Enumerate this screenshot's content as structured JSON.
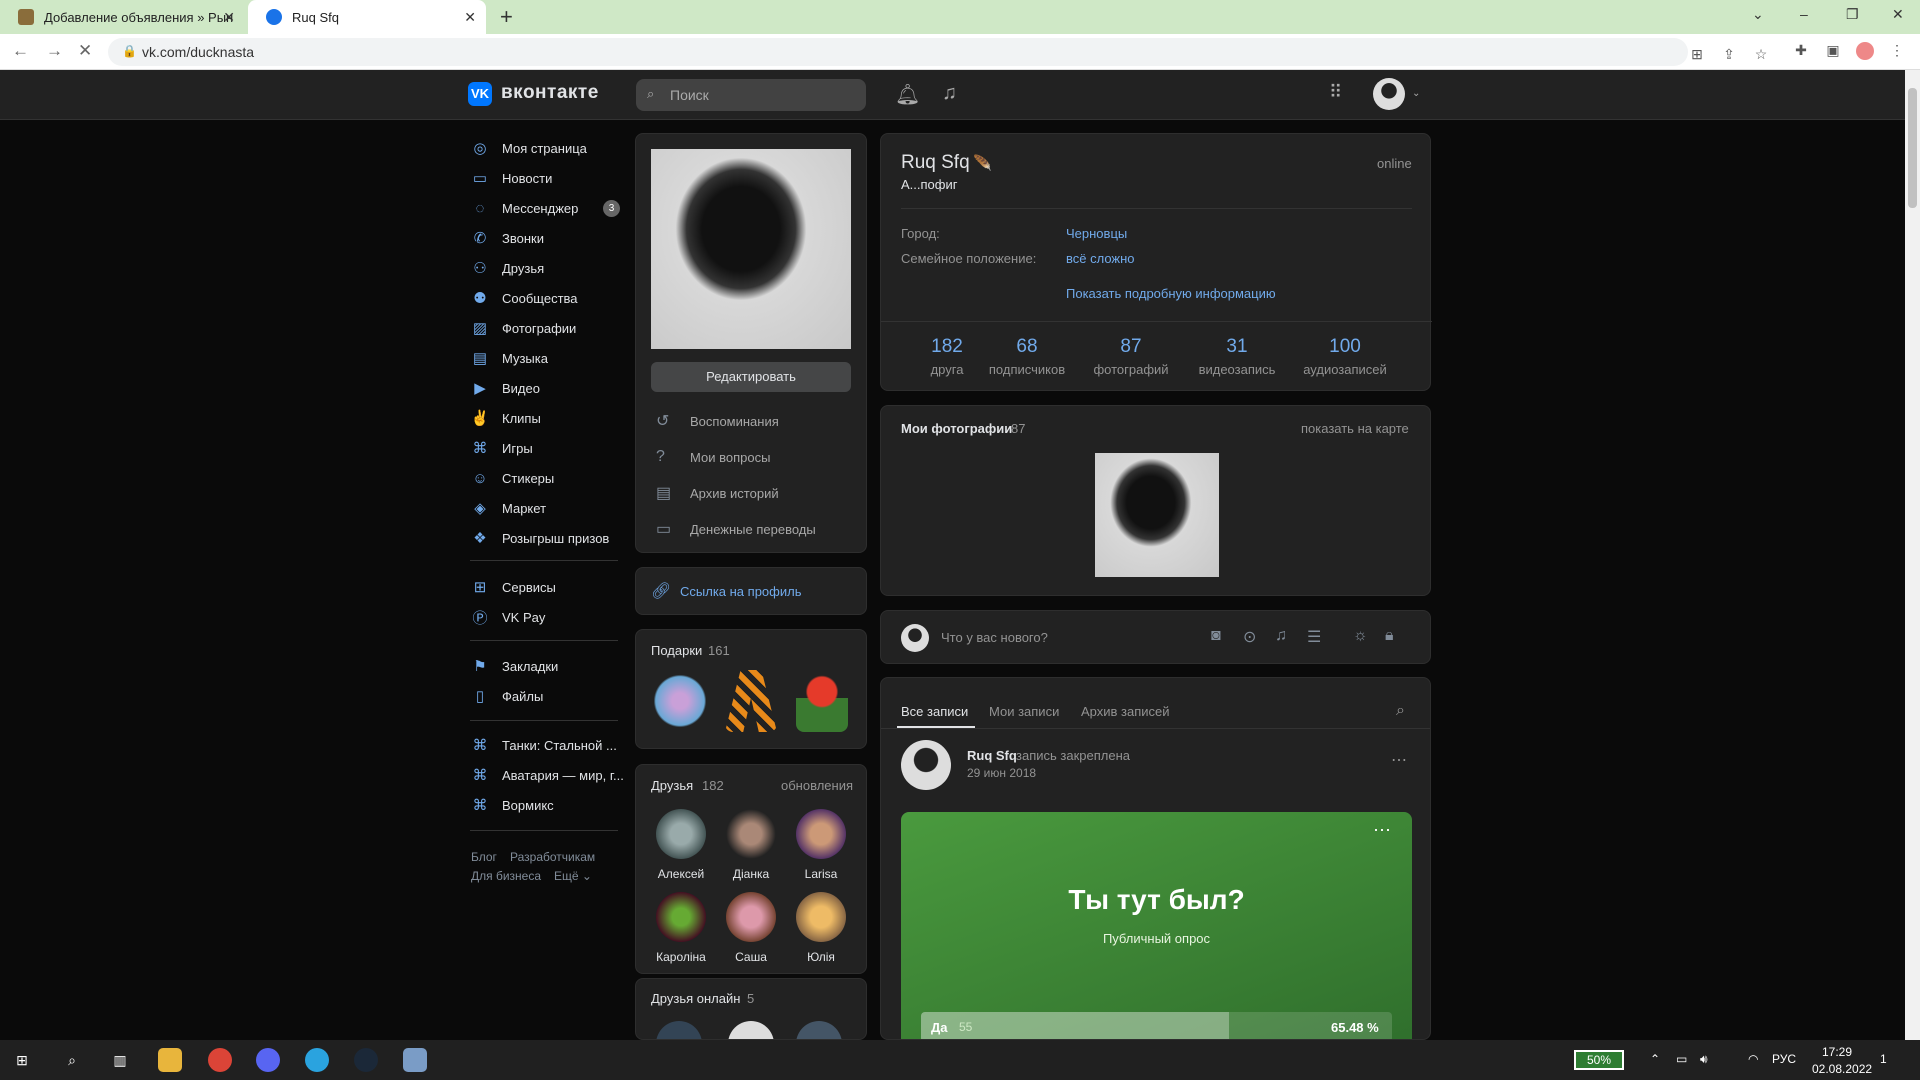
{
  "browser": {
    "tabs": [
      {
        "title": "Добавление объявления » Рын"
      },
      {
        "title": "Ruq Sfq"
      }
    ],
    "new_tab": "+",
    "url": "vk.com/ducknasta",
    "controls": {
      "minimize": "–",
      "restore": "❐",
      "close": "✕",
      "dropdown": "⌄"
    }
  },
  "vk_header": {
    "logo_letter": "VK",
    "logo_text": "вконтакте",
    "search_placeholder": "Поиск"
  },
  "sidebar": {
    "items": [
      {
        "label": "Моя страница",
        "icon": "user-circle-icon"
      },
      {
        "label": "Новости",
        "icon": "news-icon"
      },
      {
        "label": "Мессенджер",
        "icon": "message-icon",
        "badge": "3"
      },
      {
        "label": "Звонки",
        "icon": "phone-icon"
      },
      {
        "label": "Друзья",
        "icon": "friends-icon"
      },
      {
        "label": "Сообщества",
        "icon": "communities-icon"
      },
      {
        "label": "Фотографии",
        "icon": "photo-icon"
      },
      {
        "label": "Музыка",
        "icon": "music-icon"
      },
      {
        "label": "Видео",
        "icon": "video-icon"
      },
      {
        "label": "Клипы",
        "icon": "clips-icon"
      },
      {
        "label": "Игры",
        "icon": "games-icon"
      },
      {
        "label": "Стикеры",
        "icon": "stickers-icon"
      },
      {
        "label": "Маркет",
        "icon": "market-icon"
      },
      {
        "label": "Розыгрыш призов",
        "icon": "gift-icon"
      }
    ],
    "items2": [
      {
        "label": "Сервисы",
        "icon": "services-icon"
      },
      {
        "label": "VK Pay",
        "icon": "vkpay-icon"
      }
    ],
    "items3": [
      {
        "label": "Закладки",
        "icon": "bookmark-icon"
      },
      {
        "label": "Файлы",
        "icon": "file-icon"
      }
    ],
    "apps": [
      {
        "label": "Танки: Стальной ..."
      },
      {
        "label": "Аватария — мир, г..."
      },
      {
        "label": "Вормикс"
      }
    ],
    "footer": {
      "blog": "Блог",
      "dev": "Разработчикам",
      "business": "Для бизнеса",
      "more": "Ещё ⌄"
    }
  },
  "profile": {
    "edit_button": "Редактировать",
    "menu": [
      "Воспоминания",
      "Мои вопросы",
      "Архив историй",
      "Денежные переводы"
    ],
    "profile_link": "Ссылка на профиль",
    "name": "Ruq Sfq",
    "status": "А...пофиг",
    "online": "online",
    "city_label": "Город:",
    "city_value": "Черновцы",
    "family_label": "Семейное положение:",
    "family_value": "всё сложно",
    "more_info": "Показать подробную информацию",
    "stats": [
      {
        "n": "182",
        "l": "друга"
      },
      {
        "n": "68",
        "l": "подписчиков"
      },
      {
        "n": "87",
        "l": "фотографий"
      },
      {
        "n": "31",
        "l": "видеозапись"
      },
      {
        "n": "100",
        "l": "аудиозаписей"
      }
    ]
  },
  "gifts": {
    "title": "Подарки",
    "count": "161"
  },
  "friends": {
    "title": "Друзья",
    "count": "182",
    "updates": "обновления",
    "list": [
      "Алексей",
      "Дiанка",
      "Larisa",
      "Кароліна",
      "Саша",
      "Юлія"
    ],
    "online_title": "Друзья онлайн",
    "online_count": "5"
  },
  "photos": {
    "title": "Мои фотографии",
    "count": "87",
    "map": "показать на карте"
  },
  "composer": {
    "placeholder": "Что у вас нового?"
  },
  "wall": {
    "tabs": [
      "Все записи",
      "Мои записи",
      "Архив записей"
    ],
    "post_author": "Ruq Sfq",
    "post_pinned": "запись закреплена",
    "post_date": "29 июн 2018",
    "poll_title": "Ты тут был?",
    "poll_type": "Публичный опрос",
    "poll_option": "Да",
    "poll_votes": "55",
    "poll_percent": "65.48 %",
    "poll_fraction": 0.6548
  },
  "taskbar": {
    "battery": "50%",
    "lang": "РУС",
    "time": "17:29",
    "date": "02.08.2022",
    "notif": "1"
  },
  "colors": {
    "accent": "#71aaeb",
    "vk_blue": "#0077ff",
    "poll_green": "#3d8a3a"
  }
}
